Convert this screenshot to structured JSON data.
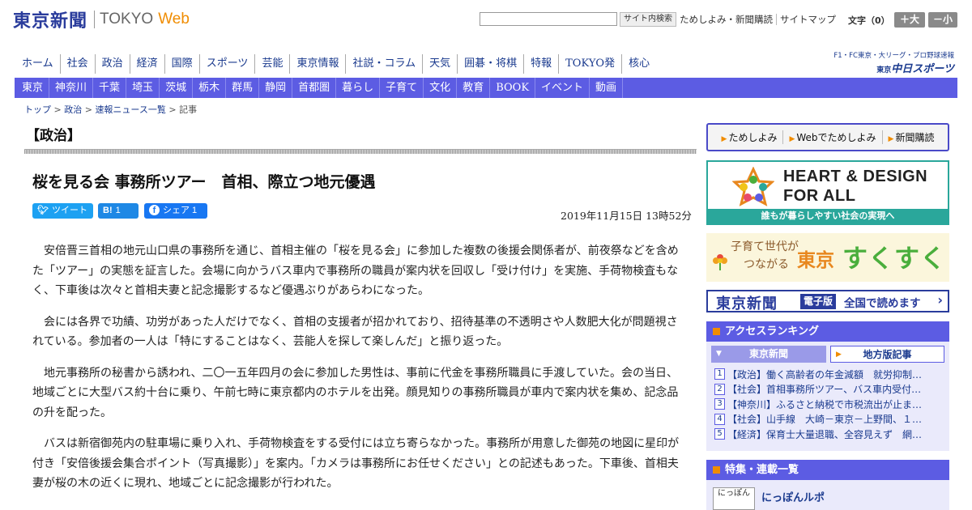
{
  "header": {
    "logo_jp": "東京新聞",
    "logo_en": "TOKYO",
    "logo_web": "Web",
    "search_button": "サイト内検索",
    "links": [
      "ためしよみ・新聞購読",
      "サイトマップ"
    ],
    "font_size_label": "文字（0）",
    "font_up": "＋大",
    "font_down": "－小"
  },
  "global_nav": [
    "ホーム",
    "社会",
    "政治",
    "経済",
    "国際",
    "スポーツ",
    "芸能",
    "東京情報",
    "社説・コラム",
    "天気",
    "囲碁・将棋",
    "特報",
    "TOKYO発",
    "核心"
  ],
  "chunichi": {
    "top": "F1・FC東京・大リーグ・プロ野球速報",
    "small": "東京",
    "main": "中日スポーツ"
  },
  "regional_nav": [
    "東京",
    "神奈川",
    "千葉",
    "埼玉",
    "茨城",
    "栃木",
    "群馬",
    "静岡",
    "首都圏",
    "暮らし",
    "子育て",
    "文化",
    "教育",
    "BOOK",
    "イベント",
    "動画"
  ],
  "breadcrumb": {
    "items": [
      "トップ",
      "政治",
      "速報ニュース一覧"
    ],
    "current": "記事"
  },
  "article": {
    "category": "【政治】",
    "title": "桜を見る会 事務所ツアー　首相、際立つ地元優遇",
    "tweet": "ツイート",
    "hatena_icon": "B!",
    "hatena_count": "1",
    "share_label": "シェア 1",
    "date": "2019年11月15日 13時52分",
    "paragraphs": [
      "安倍晋三首相の地元山口県の事務所を通じ、首相主催の「桜を見る会」に参加した複数の後援会関係者が、前夜祭などを含めた「ツアー」の実態を証言した。会場に向かうバス車内で事務所の職員が案内状を回収し「受け付け」を実施、手荷物検査もなく、下車後は次々と首相夫妻と記念撮影するなど優遇ぶりがあらわになった。",
      "会には各界で功績、功労があった人だけでなく、首相の支援者が招かれており、招待基準の不透明さや人数肥大化が問題視されている。参加者の一人は「特にすることはなく、芸能人を探して楽しんだ」と振り返った。",
      "地元事務所の秘書から誘われ、二〇一五年四月の会に参加した男性は、事前に代金を事務所職員に手渡していた。会の当日、地域ごとに大型バス約十台に乗り、午前七時に東京都内のホテルを出発。顔見知りの事務所職員が車内で案内状を集め、記念品の升を配った。",
      "バスは新宿御苑内の駐車場に乗り入れ、手荷物検査をする受付には立ち寄らなかった。事務所が用意した御苑の地図に星印が付き「安倍後援会集合ポイント（写真撮影）」を案内。「カメラは事務所にお任せください」との記述もあった。下車後、首相夫妻が桜の木の近くに現れ、地域ごとに記念撮影が行われた。"
    ]
  },
  "sidebar": {
    "trial_links": [
      "ためしよみ",
      "Webでためしよみ",
      "新聞購読"
    ],
    "heart_title_1": "HEART & DESIGN",
    "heart_title_2": "FOR ALL",
    "heart_caption": "誰もが暮らしやすい社会の実現へ",
    "suku_lead_1": "子育て世代が",
    "suku_lead_2": "つながる",
    "suku_tokyo": "東京",
    "suku_main": "すくすく",
    "edition_name": "東京新聞",
    "edition_badge": "電子版",
    "edition_text": "全国で読めます",
    "ranking_title": "アクセスランキング",
    "ranking_tab_active": "東京新聞",
    "ranking_tab_other": "地方版記事",
    "ranking_items": [
      {
        "num": "1",
        "text": "【政治】働く高齢者の年金減額　就労抑制…"
      },
      {
        "num": "2",
        "text": "【社会】首相事務所ツアー、バス車内受付…"
      },
      {
        "num": "3",
        "text": "【神奈川】ふるさと納税で市税流出が止ま…"
      },
      {
        "num": "4",
        "text": "【社会】山手線　大崎－東京－上野間、１…"
      },
      {
        "num": "5",
        "text": "【経済】保育士大量退職、全容見えず　網…"
      }
    ],
    "features_title": "特集・連載一覧",
    "feature_badge": "にっぽん",
    "feature_title": "にっぽんルポ"
  }
}
